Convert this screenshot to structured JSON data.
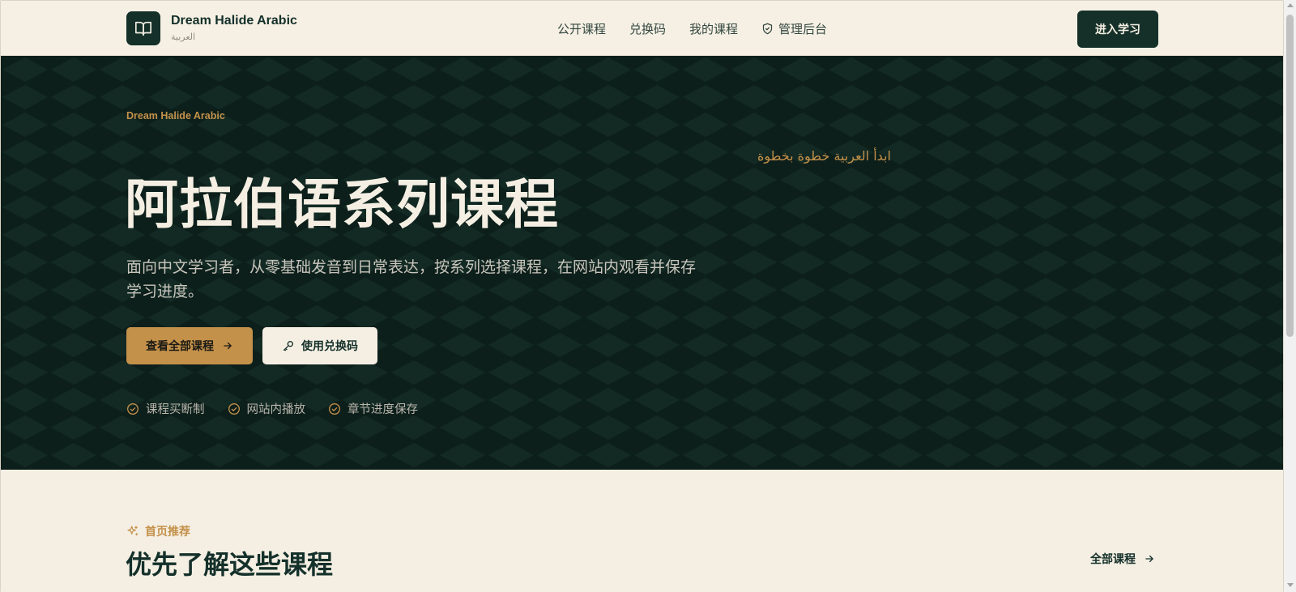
{
  "header": {
    "brand_name": "Dream Halide Arabic",
    "brand_sub": "العربية",
    "nav": [
      {
        "label": "公开课程"
      },
      {
        "label": "兑换码"
      },
      {
        "label": "我的课程"
      },
      {
        "label": "管理后台"
      }
    ],
    "enter_label": "进入学习"
  },
  "hero": {
    "eyebrow": "Dream Halide Arabic",
    "arabic_tagline": "ابدأ العربية خطوة بخطوة",
    "title": "阿拉伯语系列课程",
    "description": "面向中文学习者，从零基础发音到日常表达，按系列选择课程，在网站内观看并保存学习进度。",
    "primary_button": "查看全部课程",
    "secondary_button": "使用兑换码",
    "features": [
      "课程买断制",
      "网站内播放",
      "章节进度保存"
    ]
  },
  "recommended": {
    "eyebrow": "首页推荐",
    "title": "优先了解这些课程",
    "all_link": "全部课程"
  },
  "colors": {
    "primary_dark": "#143029",
    "hero_bg": "#0d1f1b",
    "accent_gold": "#c4914a",
    "cream": "#f5efe3"
  },
  "icons": {
    "logo": "open-book-icon",
    "admin": "shield-check-icon",
    "primary_button": "arrow-right-icon",
    "secondary_button": "key-icon",
    "feature": "check-circle-icon",
    "recommended": "sparkles-icon",
    "all_link": "arrow-right-icon"
  }
}
